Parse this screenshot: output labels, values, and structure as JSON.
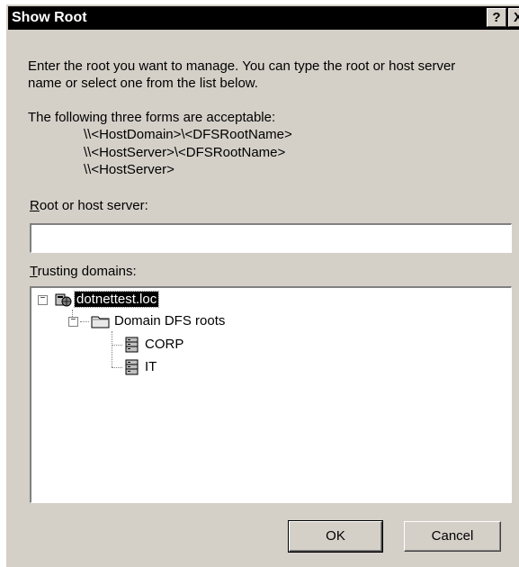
{
  "window": {
    "title": "Show Root",
    "help_button": "?",
    "close_button": "X"
  },
  "instructions": {
    "line1": "Enter the root you want to manage. You can type the root or host server",
    "line2": "name or select one from the list below.",
    "forms_intro": "The following three forms are acceptable:",
    "forms": [
      "\\\\<HostDomain>\\<DFSRootName>",
      "\\\\<HostServer>\\<DFSRootName>",
      "\\\\<HostServer>"
    ]
  },
  "root_field": {
    "label_accel": "R",
    "label_rest": "oot or host server:",
    "value": ""
  },
  "trusting": {
    "label_accel": "T",
    "label_rest": "rusting domains:"
  },
  "tree": {
    "domain": {
      "label": "dotnettest.loc",
      "expanded": true,
      "selected": true,
      "icon": "domain-icon"
    },
    "folder": {
      "label": "Domain DFS roots",
      "expanded": true,
      "icon": "folder-icon"
    },
    "roots": [
      {
        "label": "CORP",
        "icon": "dfs-root-icon"
      },
      {
        "label": "IT",
        "icon": "dfs-root-icon"
      }
    ]
  },
  "buttons": {
    "ok": "OK",
    "cancel": "Cancel"
  }
}
